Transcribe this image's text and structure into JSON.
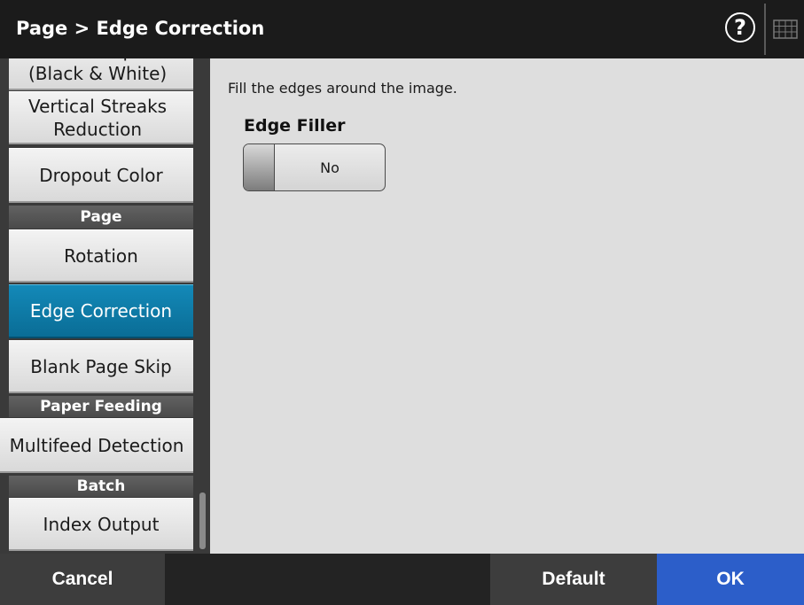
{
  "header": {
    "title": "Page > Edge Correction",
    "help_glyph": "?",
    "help_icon": "question-circle-icon",
    "keyboard_icon": "keyboard-icon"
  },
  "sidebar": {
    "partial_item": "Cleanup\n(Black & White)",
    "items": [
      {
        "label": "Vertical Streaks\nReduction"
      },
      {
        "label": "Dropout Color"
      },
      {
        "label": "Rotation"
      },
      {
        "label": "Edge Correction",
        "selected": true
      },
      {
        "label": "Blank Page Skip"
      },
      {
        "label": "Multifeed Detection"
      },
      {
        "label": "Index Output"
      }
    ],
    "sections": {
      "page": "Page",
      "paper_feeding": "Paper Feeding",
      "batch": "Batch"
    }
  },
  "content": {
    "description": "Fill the edges around the image.",
    "edge_filler": {
      "label": "Edge Filler",
      "value": "No"
    }
  },
  "footer": {
    "cancel": "Cancel",
    "default": "Default",
    "ok": "OK"
  },
  "colors": {
    "header_bg": "#1b1b1b",
    "selected_item": "#0a6d96",
    "ok_button": "#2c5ec9",
    "content_bg": "#dedede"
  }
}
